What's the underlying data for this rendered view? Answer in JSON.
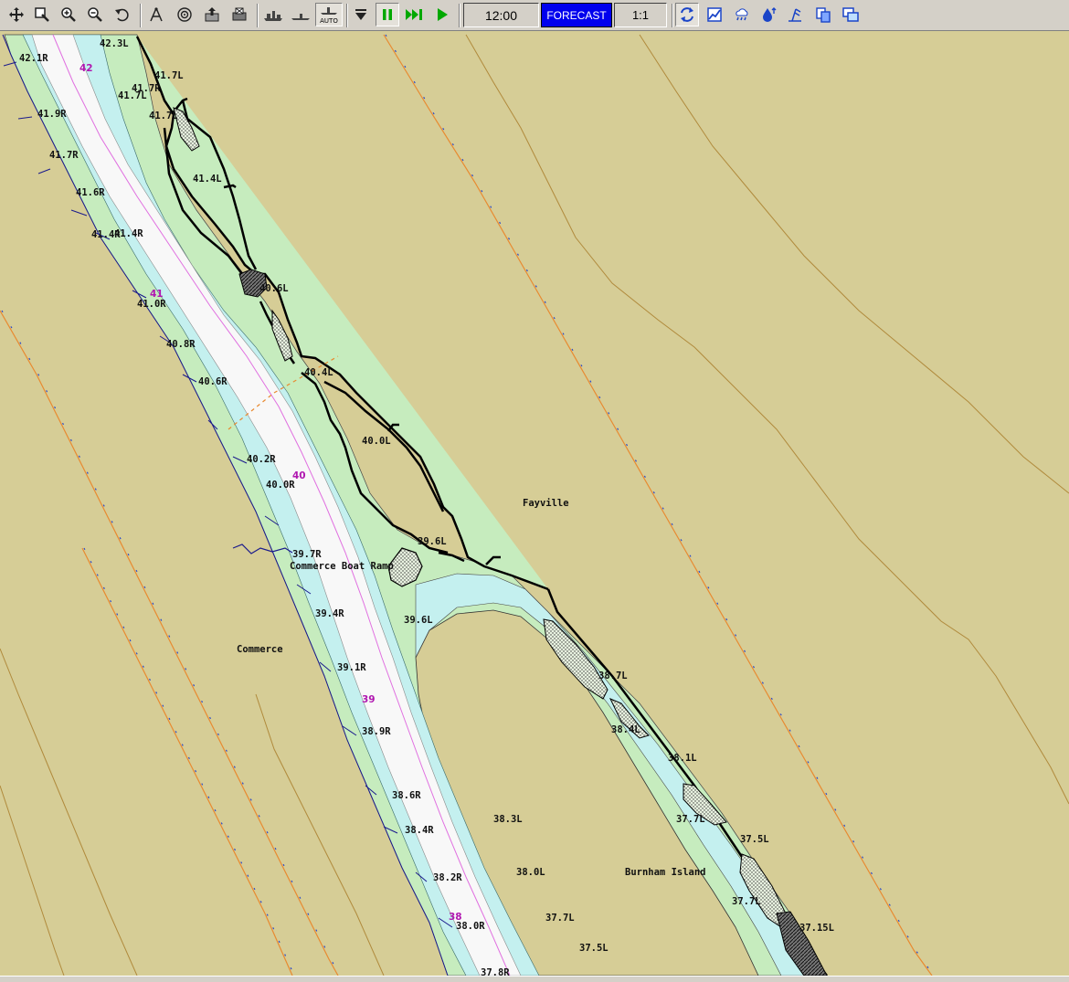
{
  "toolbar": {
    "auto_label": "AUTO",
    "time": "12:00",
    "forecast_label": "FORECAST",
    "scale": "1:1",
    "tools": [
      "pan-icon",
      "zoom-window-icon",
      "zoom-in-icon",
      "zoom-out-icon",
      "undo-icon",
      "measure-icon",
      "target-icon",
      "export-icon",
      "print-icon",
      "towboat-icon",
      "vessel-icon",
      "auto-track-icon",
      "step-icon",
      "pause-icon",
      "fast-forward-icon",
      "play-icon",
      "refresh-icon",
      "chart-icon",
      "weather-icon",
      "water-level-icon",
      "wind-icon",
      "copy-icon",
      "windows-icon"
    ]
  },
  "map": {
    "colors": {
      "land": "#d6cd96",
      "shallow": "#c6ecbe",
      "water": "#c4f0ef",
      "channel": "#f8f8f8",
      "sailing_line": "#e070e0",
      "levee": "#000000"
    },
    "places": [
      "Fayville",
      "Commerce",
      "Commerce Boat Ramp",
      "Burnham Island"
    ],
    "river_miles": [
      "42",
      "41",
      "40",
      "39",
      "38"
    ],
    "mile_labels": [
      "42.3L",
      "42.1R",
      "41.7L",
      "41.7R",
      "41.7L",
      "41.9R",
      "41.7L",
      "41.7R",
      "41.4L",
      "41.6R",
      "41.4R",
      "41.4R",
      "40.6L",
      "41.0R",
      "40.8R",
      "40.4L",
      "40.6R",
      "40.0L",
      "40.2R",
      "40.0R",
      "39.6L",
      "39.7R",
      "39.6L",
      "39.4R",
      "38.7L",
      "39.1R",
      "38.4L",
      "38.9R",
      "38.1L",
      "38.6R",
      "37.7L",
      "38.3L",
      "38.4R",
      "37.5L",
      "38.0L",
      "38.2R",
      "37.7L",
      "37.7L",
      "38.0R",
      "37.15L",
      "37.5L",
      "37.8R"
    ]
  }
}
